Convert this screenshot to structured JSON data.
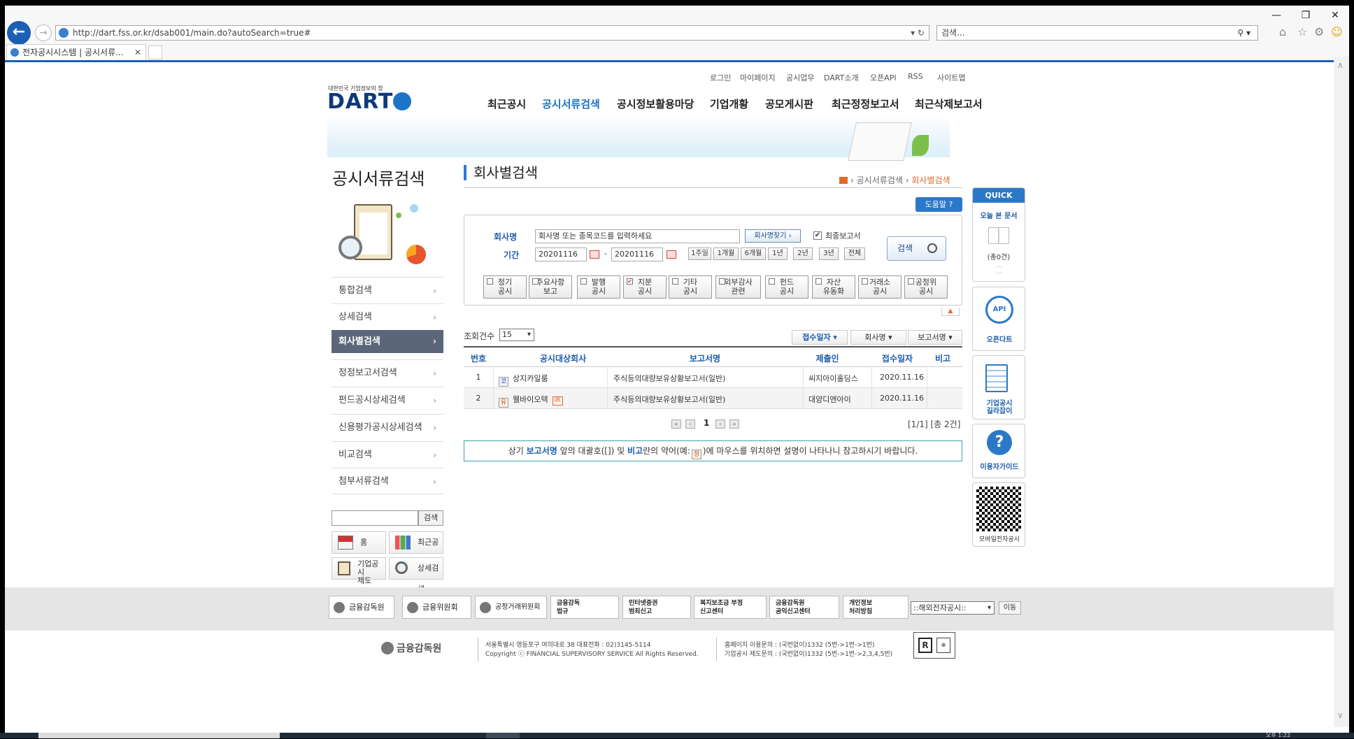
{
  "browser": {
    "url": "http://dart.fss.or.kr/dsab001/main.do?autoSearch=true#",
    "search_placeholder": "검색...",
    "tab_title": "전자공시시스템 | 공시서류..."
  },
  "util_nav": [
    "로그인",
    "마이페이지",
    "공시업무",
    "DART소개",
    "오픈API",
    "RSS",
    "사이트맵"
  ],
  "logo": {
    "tagline": "대한민국 기업정보의 창",
    "text": "DART"
  },
  "gnav": [
    "최근공시",
    "공시서류검색",
    "공시정보활용마당",
    "기업개황",
    "공모게시판",
    "최근정정보고서",
    "최근삭제보고서"
  ],
  "sidebar": {
    "title": "공시서류검색",
    "items": [
      "통합검색",
      "상세검색",
      "회사별검색",
      "정정보고서검색",
      "펀드공시상세검색",
      "신용평가공시상세검색",
      "비교검색",
      "첨부서류검색"
    ],
    "search_btn": "검색",
    "quick": {
      "home": "홈",
      "recent": "최근공시",
      "system_line1": "기업공시",
      "system_line2": "제도",
      "detail": "상세검색"
    }
  },
  "page": {
    "title": "회사별검색",
    "breadcrumb": [
      "공시서류검색",
      "회사별검색"
    ],
    "help": "도움말"
  },
  "search": {
    "company_label": "회사명",
    "company_placeholder": "회사명 또는 종목코드를 입력하세요",
    "find_btn": "회사명찾기 ›",
    "final_report": "최종보고서",
    "period_label": "기간",
    "date_from": "20201116",
    "date_dash": "-",
    "date_to": "20201116",
    "periods": [
      "1주일",
      "1개월",
      "6개월",
      "1년",
      "2년",
      "3년",
      "전체"
    ],
    "search_btn": "검색",
    "types": [
      {
        "l1": "정기",
        "l2": "공시",
        "checked": false
      },
      {
        "l1": "주요사항",
        "l2": "보고",
        "checked": false
      },
      {
        "l1": "발행",
        "l2": "공시",
        "checked": false
      },
      {
        "l1": "지분",
        "l2": "공시",
        "checked": true
      },
      {
        "l1": "기타",
        "l2": "공시",
        "checked": false
      },
      {
        "l1": "외부감사",
        "l2": "관련",
        "checked": false
      },
      {
        "l1": "펀드",
        "l2": "공시",
        "checked": false
      },
      {
        "l1": "자산",
        "l2": "유동화",
        "checked": false
      },
      {
        "l1": "거래소",
        "l2": "공시",
        "checked": false
      },
      {
        "l1": "공정위",
        "l2": "공시",
        "checked": false
      }
    ]
  },
  "results": {
    "count_label": "조회건수",
    "count_value": "15",
    "sort": [
      "접수일자 ▾",
      "회사명 ▾",
      "보고서명 ▾"
    ],
    "headers": [
      "번호",
      "공시대상회사",
      "보고서명",
      "제출인",
      "접수일자",
      "비고"
    ],
    "rows": [
      {
        "no": "1",
        "badge": "코",
        "company": "상지카일룸",
        "ir": "",
        "report": "주식등의대량보유상황보고서(일반)",
        "submitter": "씨지아이홀딩스",
        "date": "2020.11.16",
        "note": ""
      },
      {
        "no": "2",
        "badge": "유",
        "company": "웰바이오텍",
        "ir": "IR",
        "report": "주식등의대량보유상황보고서(일반)",
        "submitter": "대양디엔아이",
        "date": "2020.11.16",
        "note": ""
      }
    ],
    "page": "1",
    "page_info": "[1/1] [총 2건]",
    "notice_1": "상기 ",
    "notice_b1": "보고서명",
    "notice_2": " 앞의 대괄호([]) 및 ",
    "notice_b2": "비고",
    "notice_3": "란의 약어(예:",
    "notice_badge": "정",
    "notice_4": ")에 마우스를 위치하면 설명이 나타나니 참고하시기 바랍니다."
  },
  "quick": {
    "header": "QUICK",
    "today_docs": "오늘 본 문서",
    "count": "(총0건)",
    "opendart": "오픈다트",
    "guide_l1": "기업공시",
    "guide_l2": "길라잡이",
    "user_guide": "이용자가이드",
    "mobile": "모바일전자공시"
  },
  "footer": {
    "links": [
      "금융감독원",
      "금융위원회",
      "공정거래위원회"
    ],
    "links2": [
      {
        "l1": "금융감독",
        "l2": "법규"
      },
      {
        "l1": "인터넷증권",
        "l2": "범죄신고"
      },
      {
        "l1": "복지보조금 부정",
        "l2": "신고센터"
      },
      {
        "l1": "금융감독원",
        "l2": "공익신고센터"
      },
      {
        "l1": "개인정보",
        "l2": "처리방침"
      }
    ],
    "select": "::해외전자공시::",
    "go": "이동",
    "org": "금융감독원",
    "addr": "서울특별시 영등포구 여의대로 38     대표전화 : 02)3145-5114",
    "copy": "Copyright ⓒ FINANCIAL SUPERVISORY SERVICE All Rights Reserved.",
    "contact1": "홈페이지 이용문의 : (국번없이)1332 (5번->1번->1번)",
    "contact2": "기업공시 제도문의 : (국번없이)1332 (5번->1번->2,3,4,5번)"
  },
  "taskbar": {
    "clock": "오후 1:22"
  }
}
